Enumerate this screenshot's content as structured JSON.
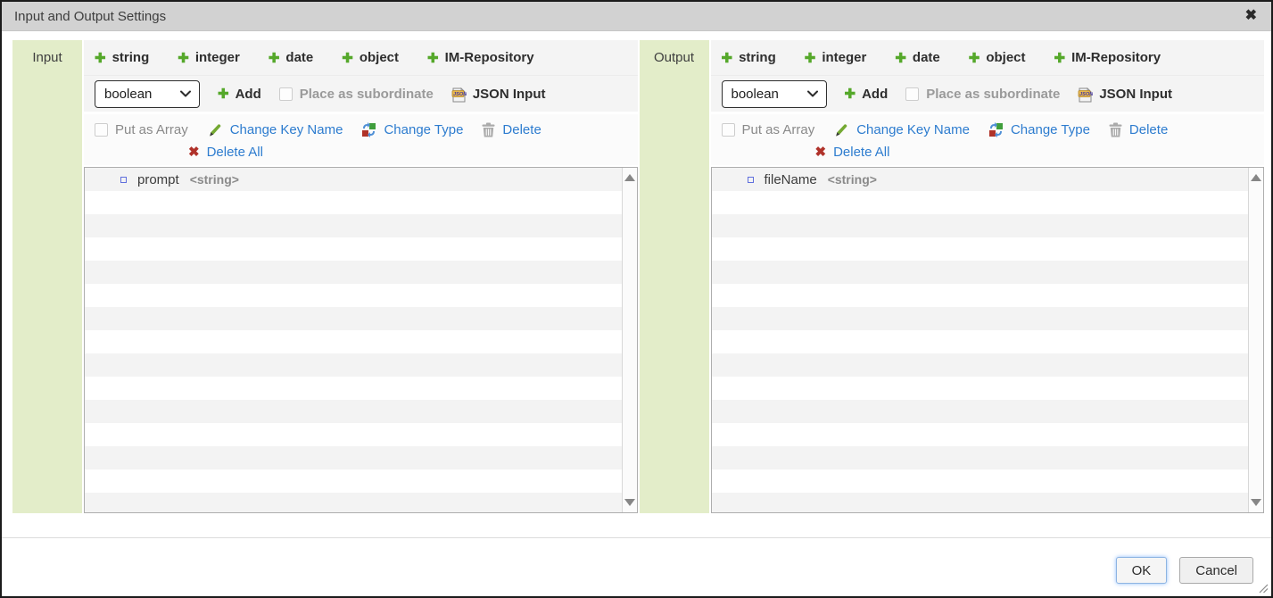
{
  "dialog": {
    "title": "Input and Output Settings"
  },
  "icons": {
    "plus": "✚",
    "close": "✖",
    "delete_all_x": "✖"
  },
  "panels": [
    {
      "label": "Input",
      "type_buttons": [
        "string",
        "integer",
        "date",
        "object",
        "IM-Repository"
      ],
      "select_value": "boolean",
      "add_label": "Add",
      "place_as_subordinate_label": "Place as subordinate",
      "json_input_label": "JSON Input",
      "put_as_array_label": "Put as Array",
      "change_key_name_label": "Change Key Name",
      "change_type_label": "Change Type",
      "delete_label": "Delete",
      "delete_all_label": "Delete All",
      "items": [
        {
          "name": "prompt",
          "type": "<string>"
        }
      ]
    },
    {
      "label": "Output",
      "type_buttons": [
        "string",
        "integer",
        "date",
        "object",
        "IM-Repository"
      ],
      "select_value": "boolean",
      "add_label": "Add",
      "place_as_subordinate_label": "Place as subordinate",
      "json_input_label": "JSON Input",
      "put_as_array_label": "Put as Array",
      "change_key_name_label": "Change Key Name",
      "change_type_label": "Change Type",
      "delete_label": "Delete",
      "delete_all_label": "Delete All",
      "items": [
        {
          "name": "fileName",
          "type": "<string>"
        }
      ]
    }
  ],
  "footer": {
    "ok_label": "OK",
    "cancel_label": "Cancel"
  },
  "colors": {
    "panel_label_bg": "#e3edc9",
    "toolbar_bg": "#f4f4f4",
    "titlebar_bg": "#d2d2d2",
    "link_blue": "#2d7ccf",
    "plus_green": "#55a82a",
    "delete_red": "#b0322a",
    "row_stripe": "#f3f3f3"
  }
}
